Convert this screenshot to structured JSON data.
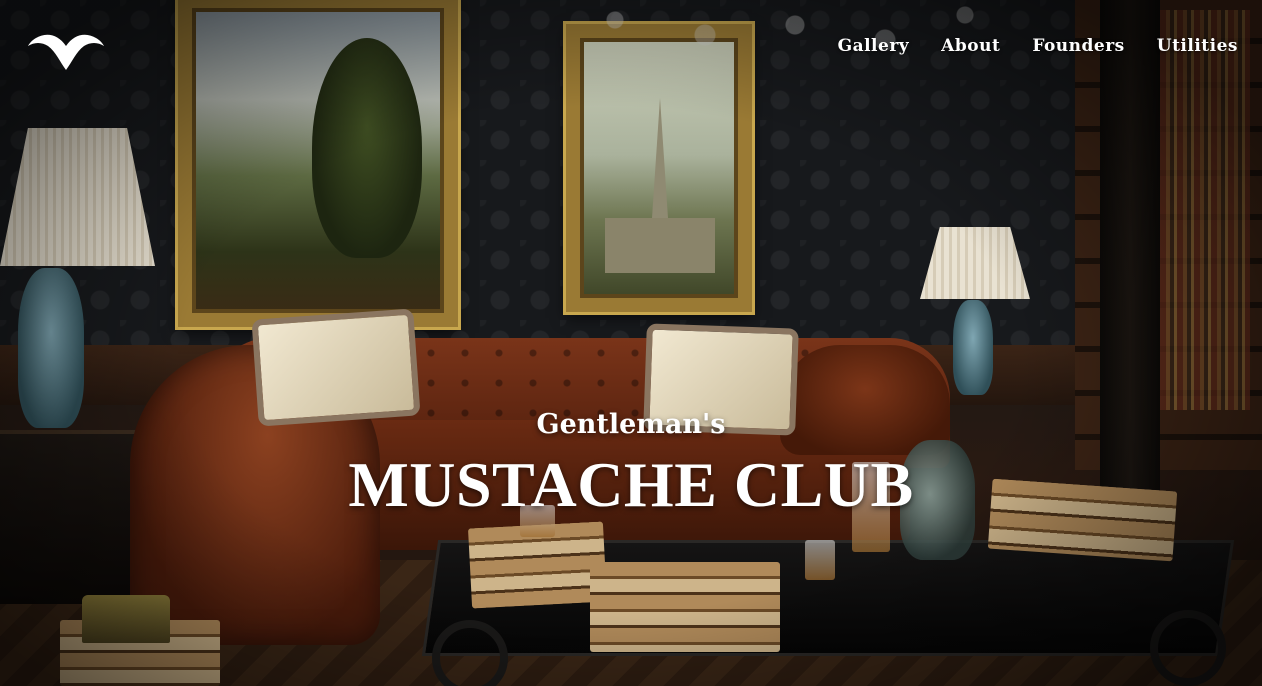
{
  "header": {
    "logo_icon": "mustache-icon",
    "nav": [
      {
        "label": "Gallery"
      },
      {
        "label": "About"
      },
      {
        "label": "Founders"
      },
      {
        "label": "Utilities"
      }
    ]
  },
  "hero": {
    "subtitle": "Gentleman's",
    "title": "MUSTACHE CLUB",
    "text_color": "#ffffff"
  }
}
